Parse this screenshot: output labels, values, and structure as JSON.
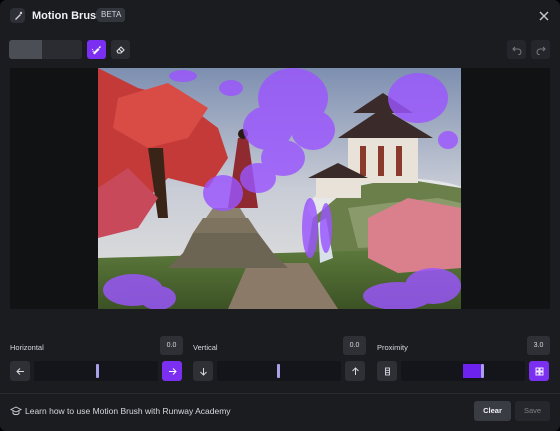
{
  "header": {
    "title": "Motion Brush",
    "badge": "BETA",
    "app_icon": "motion-brush-icon",
    "close_icon": "close-icon"
  },
  "toolbar": {
    "brush_size_fraction": 0.45,
    "brush_icon": "brush-icon",
    "eraser_icon": "eraser-icon",
    "undo_icon": "undo-icon",
    "redo_icon": "redo-icon"
  },
  "controls": {
    "horizontal": {
      "label": "Horizontal",
      "value": "0.0",
      "left_icon": "arrow-left-icon",
      "right_icon": "arrow-right-icon"
    },
    "vertical": {
      "label": "Vertical",
      "value": "0.0",
      "down_icon": "arrow-down-icon",
      "up_icon": "arrow-up-icon"
    },
    "proximity": {
      "label": "Proximity",
      "value": "3.0",
      "far_icon": "proximity-far-icon",
      "near_icon": "proximity-near-icon"
    }
  },
  "footer": {
    "academy_text": "Learn how to use Motion Brush with Runway Academy",
    "academy_icon": "graduation-cap-icon",
    "clear_label": "Clear",
    "save_label": "Save"
  },
  "colors": {
    "accent": "#7b2ff0",
    "background": "#1b1c20",
    "brush_overlay": "#9b55ff"
  }
}
